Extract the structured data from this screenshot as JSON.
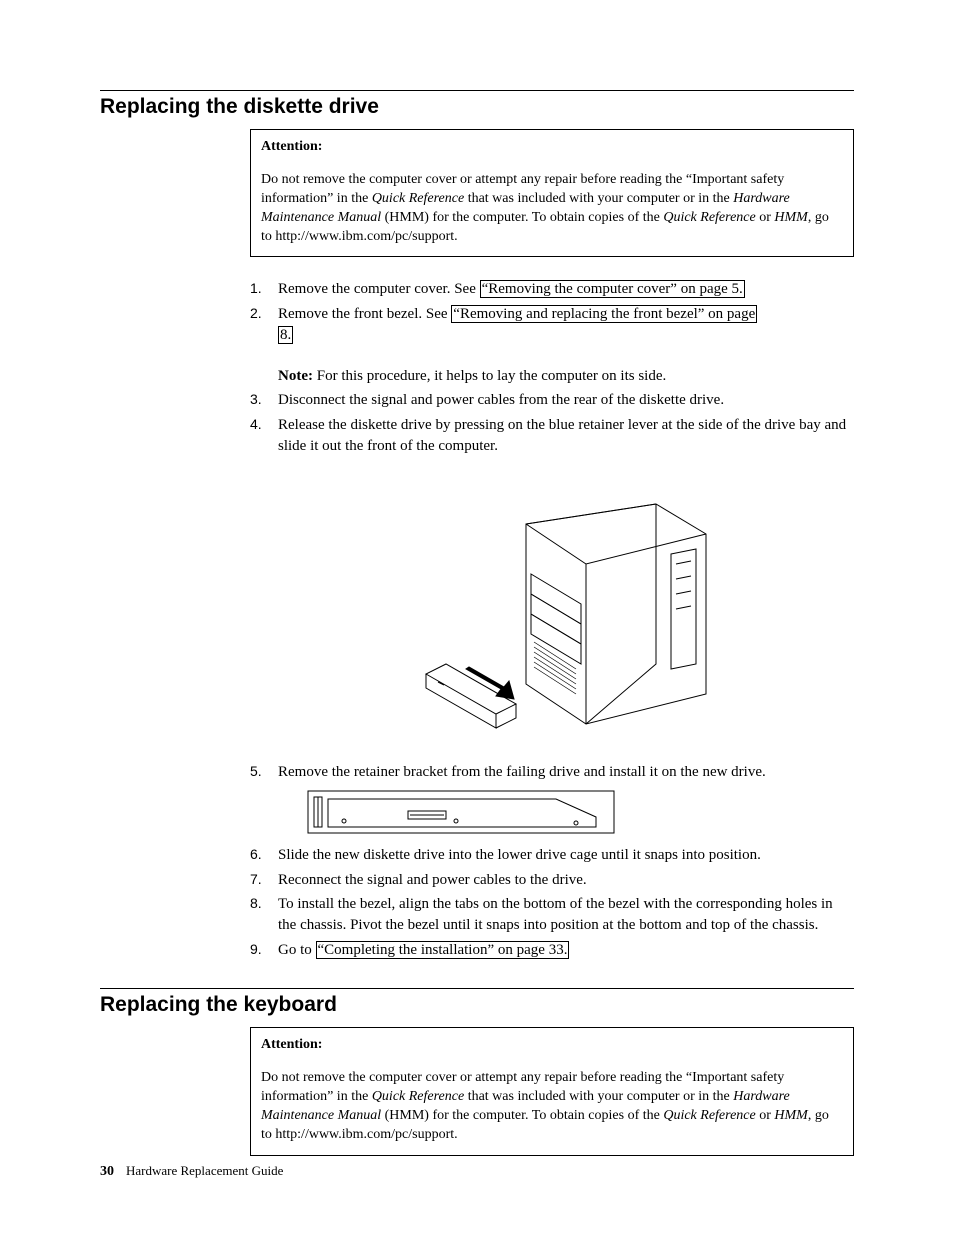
{
  "section1": {
    "heading": "Replacing the diskette drive",
    "attention_label": "Attention:",
    "attention_body_1": "Do not remove the computer cover or attempt any repair before reading the “Important safety information” in the ",
    "attention_i1": "Quick Reference",
    "attention_body_2": " that was included with your computer or in the ",
    "attention_i2": "Hardware Maintenance Manual",
    "attention_body_3": " (HMM) for the computer. To obtain copies of the ",
    "attention_i3": "Quick Reference",
    "attention_body_4": " or ",
    "attention_i4": "HMM",
    "attention_body_5": ", go to http://www.ibm.com/pc/support.",
    "steps": {
      "s1_a": "Remove the computer cover. See ",
      "s1_link": "“Removing the computer cover” on page 5.",
      "s2_a": "Remove the front bezel. See ",
      "s2_link1": "“Removing and replacing the front bezel” on page",
      "s2_link2": "8.",
      "s2_note_label": "Note:",
      "s2_note": " For this procedure, it helps to lay the computer on its side.",
      "s3": "Disconnect the signal and power cables from the rear of the diskette drive.",
      "s4": "Release the diskette drive by pressing on the blue retainer lever at the side of the drive bay and slide it out the front of the computer.",
      "s5": "Remove the retainer bracket from the failing drive and install it on the new drive.",
      "s6": "Slide the new diskette drive into the lower drive cage until it snaps into position.",
      "s7": "Reconnect the signal and power cables to the drive.",
      "s8": "To install the bezel, align the tabs on the bottom of the bezel with the corresponding holes in the chassis. Pivot the bezel until it snaps into position at the bottom and top of the chassis.",
      "s9_a": "Go to ",
      "s9_link": "“Completing the installation” on page 33."
    }
  },
  "section2": {
    "heading": "Replacing the keyboard",
    "attention_label": "Attention:",
    "attention_body_1": "Do not remove the computer cover or attempt any repair before reading the “Important safety information” in the ",
    "attention_i1": "Quick Reference",
    "attention_body_2": " that was included with your computer or in the ",
    "attention_i2": "Hardware Maintenance Manual",
    "attention_body_3": " (HMM) for the computer. To obtain copies of the ",
    "attention_i3": "Quick Reference",
    "attention_body_4": " or ",
    "attention_i4": "HMM",
    "attention_body_5": ", go to http://www.ibm.com/pc/support."
  },
  "footer": {
    "page": "30",
    "title": "Hardware Replacement Guide"
  }
}
